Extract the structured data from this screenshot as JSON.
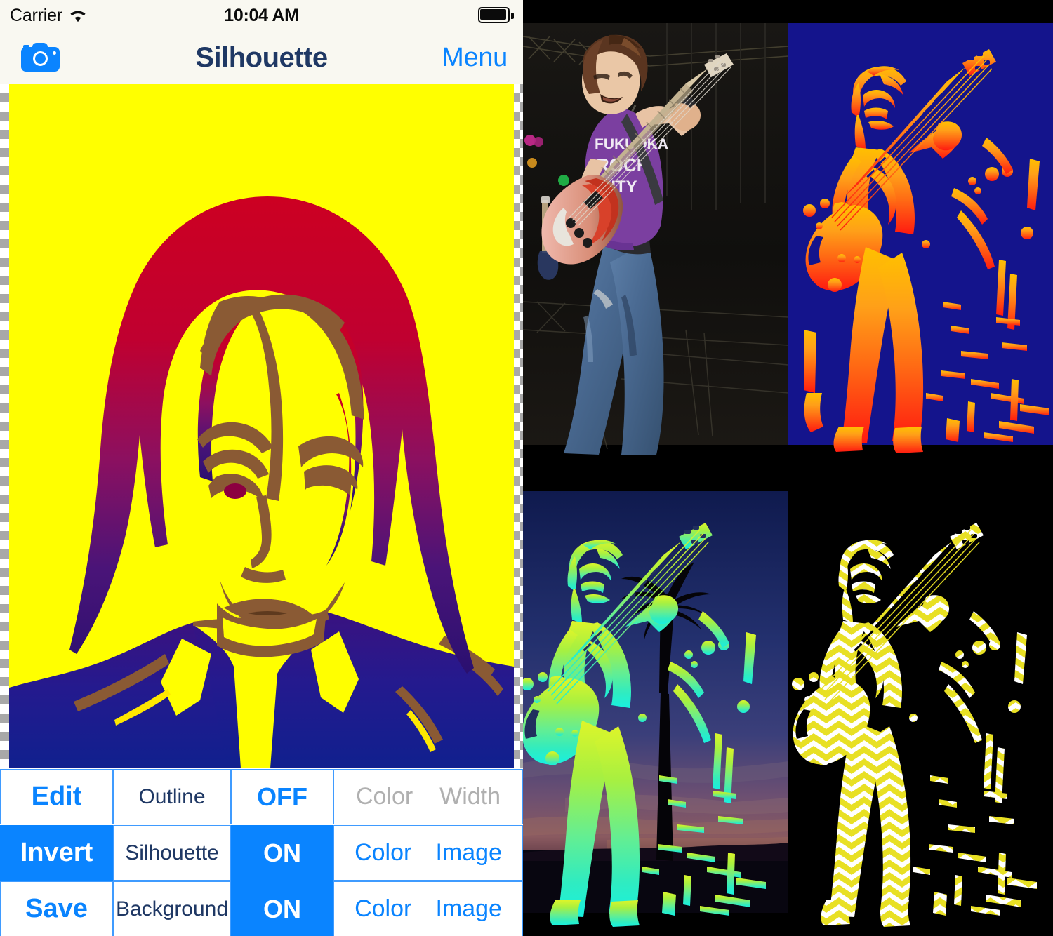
{
  "statusbar": {
    "carrier": "Carrier",
    "wifi_icon": "wifi-icon",
    "time": "10:04 AM",
    "battery_icon": "battery-full-icon"
  },
  "navbar": {
    "camera_icon": "camera-icon",
    "title": "Silhouette",
    "menu_label": "Menu"
  },
  "canvas": {
    "background_pattern": "transparency-checkerboard",
    "artwork_colors": {
      "background": "#ffff00",
      "hair_top": "#cc0022",
      "hair_bottom": "#2a1070",
      "outline": "#8a5a34",
      "jacket": "#1a1a8c"
    }
  },
  "controls": {
    "rows": [
      {
        "action": "Edit",
        "action_on": false,
        "label": "Outline",
        "toggle": "OFF",
        "toggle_on": false,
        "options": [
          {
            "text": "Color",
            "enabled": false
          },
          {
            "text": "Width",
            "enabled": false
          }
        ]
      },
      {
        "action": "Invert",
        "action_on": true,
        "label": "Silhouette",
        "toggle": "ON",
        "toggle_on": true,
        "options": [
          {
            "text": "Color",
            "enabled": true
          },
          {
            "text": "Image",
            "enabled": true
          }
        ]
      },
      {
        "action": "Save",
        "action_on": false,
        "label": "Background",
        "toggle": "ON",
        "toggle_on": true,
        "options": [
          {
            "text": "Color",
            "enabled": true
          },
          {
            "text": "Image",
            "enabled": true
          }
        ]
      }
    ]
  },
  "gallery": {
    "items": [
      {
        "name": "photo-original-bassist",
        "description": "Original photo of bass guitarist on stage",
        "colors": {
          "shirt": "#7b3fa0",
          "guitar": "#e8816a",
          "jeans": "#4a6c99",
          "backdrop": "#141414"
        }
      },
      {
        "name": "photo-silhouette-orange-on-blue",
        "description": "Silhouette with orange gradient figure on navy blue background",
        "colors": {
          "background": "#14148c",
          "figure_top": "#ffb400",
          "figure_bottom": "#ff2200"
        }
      },
      {
        "name": "photo-silhouette-green-on-sunset",
        "description": "Silhouette with green to cyan gradient figure over sunset sky background",
        "colors": {
          "sky_top": "#14205e",
          "sky_mid": "#3a3f78",
          "figure_top": "#c8f032",
          "figure_bottom": "#2ee8c8"
        }
      },
      {
        "name": "photo-silhouette-chevron-on-black",
        "description": "Silhouette with yellow and white chevron pattern fill on black background",
        "colors": {
          "background": "#000000",
          "stripe_a": "#e8e024",
          "stripe_b": "#ffffff"
        }
      }
    ]
  }
}
